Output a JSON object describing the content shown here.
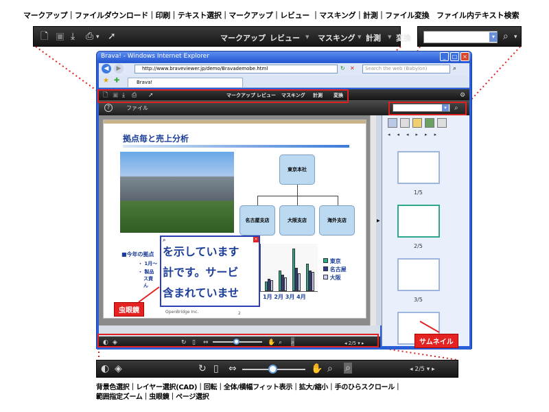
{
  "top_labels": {
    "features": "マークアップ｜ファイルダウンロード｜印刷｜テキスト選択｜マークアップ｜レビュー ｜マスキング｜計測｜ファイル変換",
    "search": "ファイル内テキスト検索"
  },
  "zoom_toolbar": {
    "menu": [
      "マークアップ",
      "レビュー",
      "マスキング",
      "計測",
      "変換"
    ],
    "icons": [
      "document-icon",
      "save-icon",
      "download-icon",
      "print-icon",
      "select-cursor-icon"
    ]
  },
  "browser": {
    "title": "Brava! - Windows Internet Explorer",
    "address": "http://www.braveviewer.jp/demo/Bravademobe.html",
    "search_placeholder": "Search the web (Babylon)",
    "tab_label": "Brava!"
  },
  "viewer": {
    "file_label": "ファイル",
    "menu": [
      "マークアップ",
      "レビュー",
      "マスキング",
      "計測",
      "変換"
    ]
  },
  "slide": {
    "title": "拠点毎と売上分析",
    "org": {
      "root": "東京本社",
      "children": [
        "名古屋支店",
        "大阪支店",
        "海外支店"
      ]
    },
    "bullet_heading": "■今年の拠点",
    "bullet_lines": [
      "・ 1月～",
      "・ 製品",
      "ス資",
      "ん"
    ],
    "magnifier_lines": [
      "を示しています",
      "計です。サービ",
      "含まれていませ"
    ],
    "legend": [
      "東京",
      "名古屋",
      "大阪"
    ],
    "months": [
      "1月",
      "2月",
      "3月",
      "4月"
    ],
    "chart_label_2": "2",
    "footer": "OpenBridge Inc.",
    "page_no": "2"
  },
  "colors": {
    "tokyo": "#2aa889",
    "nagoya": "#2e3a8c",
    "osaka": "#c8cef0",
    "callout": "#e52222",
    "toolbar_dark": "#1c1c1c"
  },
  "page_nav": {
    "pager": "2/5"
  },
  "thumbnails": [
    {
      "label": "1/5"
    },
    {
      "label": "2/5"
    },
    {
      "label": "3/5"
    },
    {
      "label": ""
    }
  ],
  "callouts": {
    "magnifier": "虫眼鏡",
    "thumbnail": "サムネイル"
  },
  "bottom_labels": {
    "line1": "背景色選択｜レイヤー選択(CAD)｜回転｜全体/横幅フィット表示｜拡大/縮小｜手のひらスクロール｜",
    "line2": "範囲指定ズーム｜虫眼鏡｜ページ選択"
  }
}
